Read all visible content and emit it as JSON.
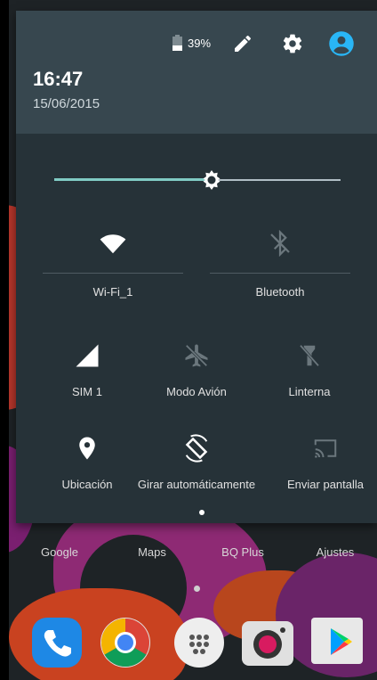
{
  "status": {
    "battery_percent": "39%",
    "battery_level": 0.39
  },
  "header": {
    "time": "16:47",
    "date": "15/06/2015",
    "icons": [
      "pencil-icon",
      "gear-icon",
      "account-icon"
    ]
  },
  "brightness": {
    "level": 0.55
  },
  "tiles": {
    "wifi": {
      "label": "Wi-Fi_1",
      "icon": "wifi-icon"
    },
    "bluetooth": {
      "label": "Bluetooth",
      "icon": "bluetooth-off-icon"
    },
    "sim": {
      "label": "SIM 1",
      "icon": "signal-icon"
    },
    "airplane": {
      "label": "Modo Avión",
      "icon": "airplane-icon"
    },
    "flashlight": {
      "label": "Linterna",
      "icon": "flashlight-icon"
    },
    "location": {
      "label": "Ubicación",
      "icon": "location-icon"
    },
    "rotate": {
      "label": "Girar automáticamente",
      "icon": "rotate-icon"
    },
    "cast": {
      "label": "Enviar pantalla",
      "icon": "cast-icon"
    }
  },
  "home": {
    "labels": [
      "Google",
      "Maps",
      "BQ Plus",
      "Ajustes"
    ],
    "dock": [
      "phone-icon",
      "chrome-icon",
      "apps-icon",
      "camera-icon",
      "play-store-icon"
    ]
  },
  "colors": {
    "accent": "#80cbc4",
    "panel": "#263238",
    "header": "#37474f",
    "account": "#29b6f6"
  }
}
